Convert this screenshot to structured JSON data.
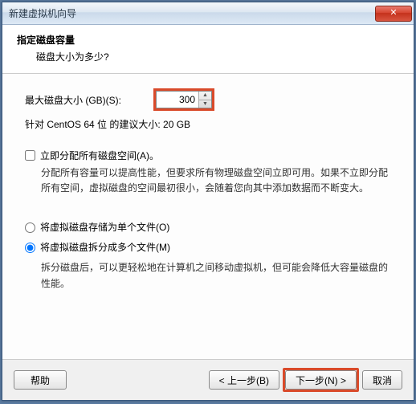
{
  "window": {
    "title": "新建虚拟机向导"
  },
  "header": {
    "heading": "指定磁盘容量",
    "subheading": "磁盘大小为多少?"
  },
  "disk": {
    "label": "最大磁盘大小 (GB)(S):",
    "value": "300",
    "recommend": "针对 CentOS 64 位 的建议大小: 20 GB"
  },
  "allocate": {
    "checkbox_label": "立即分配所有磁盘空间(A)。",
    "desc": "分配所有容量可以提高性能，但要求所有物理磁盘空间立即可用。如果不立即分配所有空间，虚拟磁盘的空间最初很小，会随着您向其中添加数据而不断变大。"
  },
  "storage": {
    "single_label": "将虚拟磁盘存储为单个文件(O)",
    "split_label": "将虚拟磁盘拆分成多个文件(M)",
    "split_desc": "拆分磁盘后，可以更轻松地在计算机之间移动虚拟机，但可能会降低大容量磁盘的性能。"
  },
  "buttons": {
    "help": "帮助",
    "back": "< 上一步(B)",
    "next": "下一步(N) >",
    "cancel": "取消",
    "close_glyph": "✕"
  }
}
